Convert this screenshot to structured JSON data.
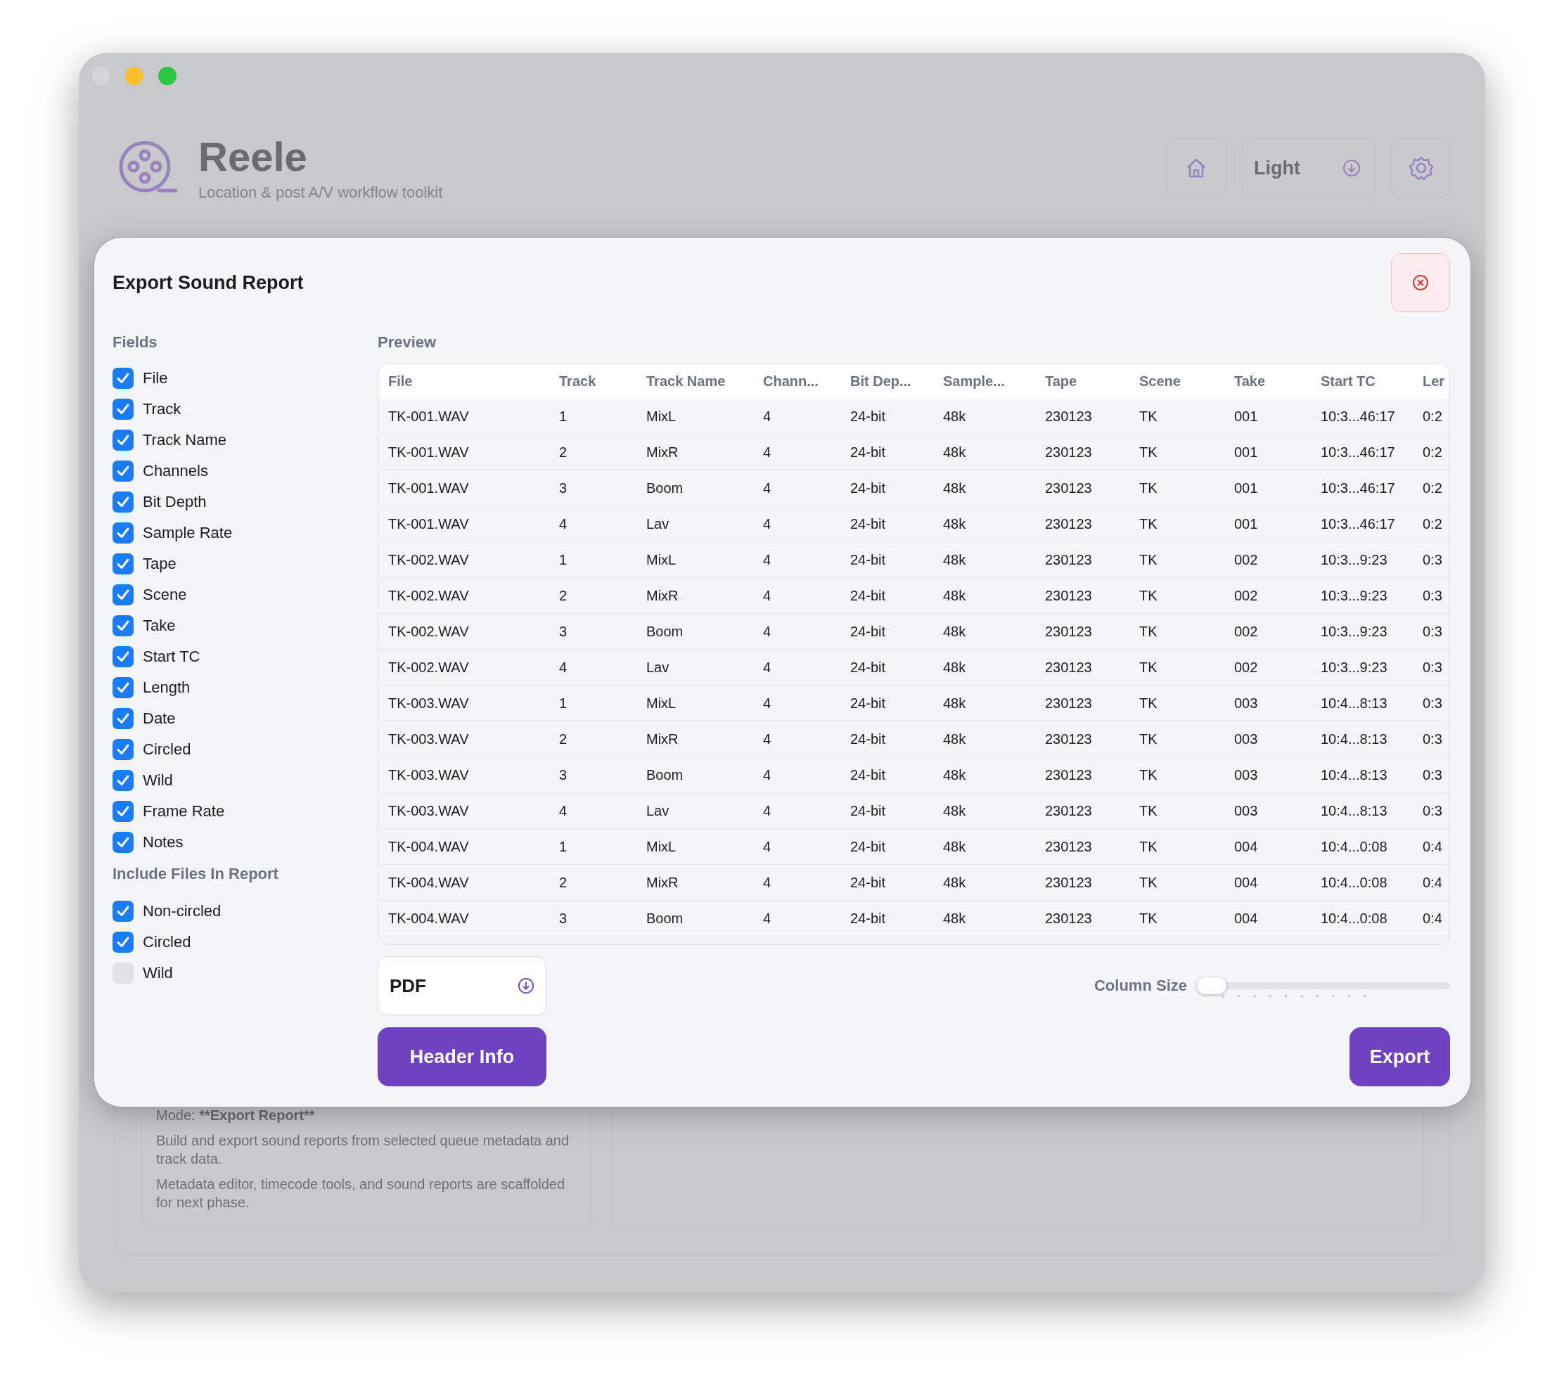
{
  "app": {
    "name": "Reele",
    "tagline": "Location & post A/V workflow toolkit",
    "theme": "Light"
  },
  "background": {
    "mode_label": "Mode:",
    "mode_value": "**Export Report**",
    "paragraphs": [
      "Build and export sound reports from selected queue metadata and track data.",
      "Metadata editor, timecode tools, and sound reports are scaffolded for next phase."
    ]
  },
  "dialog": {
    "title": "Export Sound Report",
    "fields_heading": "Fields",
    "fields": [
      {
        "label": "File",
        "checked": true
      },
      {
        "label": "Track",
        "checked": true
      },
      {
        "label": "Track Name",
        "checked": true
      },
      {
        "label": "Channels",
        "checked": true
      },
      {
        "label": "Bit Depth",
        "checked": true
      },
      {
        "label": "Sample Rate",
        "checked": true
      },
      {
        "label": "Tape",
        "checked": true
      },
      {
        "label": "Scene",
        "checked": true
      },
      {
        "label": "Take",
        "checked": true
      },
      {
        "label": "Start TC",
        "checked": true
      },
      {
        "label": "Length",
        "checked": true
      },
      {
        "label": "Date",
        "checked": true
      },
      {
        "label": "Circled",
        "checked": true
      },
      {
        "label": "Wild",
        "checked": true
      },
      {
        "label": "Frame Rate",
        "checked": true
      },
      {
        "label": "Notes",
        "checked": true
      }
    ],
    "include_heading": "Include Files In Report",
    "include": [
      {
        "label": "Non-circled",
        "checked": true
      },
      {
        "label": "Circled",
        "checked": true
      },
      {
        "label": "Wild",
        "checked": false
      }
    ],
    "preview_heading": "Preview",
    "table": {
      "columns": [
        "File",
        "Track",
        "Track Name",
        "Chann...",
        "Bit Dep...",
        "Sample...",
        "Tape",
        "Scene",
        "Take",
        "Start TC",
        "Ler"
      ],
      "rows": [
        [
          "TK-001.WAV",
          "1",
          "MixL",
          "4",
          "24-bit",
          "48k",
          "230123",
          "TK",
          "001",
          "10:3...46:17",
          "0:2"
        ],
        [
          "TK-001.WAV",
          "2",
          "MixR",
          "4",
          "24-bit",
          "48k",
          "230123",
          "TK",
          "001",
          "10:3...46:17",
          "0:2"
        ],
        [
          "TK-001.WAV",
          "3",
          "Boom",
          "4",
          "24-bit",
          "48k",
          "230123",
          "TK",
          "001",
          "10:3...46:17",
          "0:2"
        ],
        [
          "TK-001.WAV",
          "4",
          "Lav",
          "4",
          "24-bit",
          "48k",
          "230123",
          "TK",
          "001",
          "10:3...46:17",
          "0:2"
        ],
        [
          "TK-002.WAV",
          "1",
          "MixL",
          "4",
          "24-bit",
          "48k",
          "230123",
          "TK",
          "002",
          "10:3...9:23",
          "0:3"
        ],
        [
          "TK-002.WAV",
          "2",
          "MixR",
          "4",
          "24-bit",
          "48k",
          "230123",
          "TK",
          "002",
          "10:3...9:23",
          "0:3"
        ],
        [
          "TK-002.WAV",
          "3",
          "Boom",
          "4",
          "24-bit",
          "48k",
          "230123",
          "TK",
          "002",
          "10:3...9:23",
          "0:3"
        ],
        [
          "TK-002.WAV",
          "4",
          "Lav",
          "4",
          "24-bit",
          "48k",
          "230123",
          "TK",
          "002",
          "10:3...9:23",
          "0:3"
        ],
        [
          "TK-003.WAV",
          "1",
          "MixL",
          "4",
          "24-bit",
          "48k",
          "230123",
          "TK",
          "003",
          "10:4...8:13",
          "0:3"
        ],
        [
          "TK-003.WAV",
          "2",
          "MixR",
          "4",
          "24-bit",
          "48k",
          "230123",
          "TK",
          "003",
          "10:4...8:13",
          "0:3"
        ],
        [
          "TK-003.WAV",
          "3",
          "Boom",
          "4",
          "24-bit",
          "48k",
          "230123",
          "TK",
          "003",
          "10:4...8:13",
          "0:3"
        ],
        [
          "TK-003.WAV",
          "4",
          "Lav",
          "4",
          "24-bit",
          "48k",
          "230123",
          "TK",
          "003",
          "10:4...8:13",
          "0:3"
        ],
        [
          "TK-004.WAV",
          "1",
          "MixL",
          "4",
          "24-bit",
          "48k",
          "230123",
          "TK",
          "004",
          "10:4...0:08",
          "0:4"
        ],
        [
          "TK-004.WAV",
          "2",
          "MixR",
          "4",
          "24-bit",
          "48k",
          "230123",
          "TK",
          "004",
          "10:4...0:08",
          "0:4"
        ],
        [
          "TK-004.WAV",
          "3",
          "Boom",
          "4",
          "24-bit",
          "48k",
          "230123",
          "TK",
          "004",
          "10:4...0:08",
          "0:4"
        ]
      ]
    },
    "format": "PDF",
    "column_size": {
      "label": "Column Size",
      "level": 0
    },
    "header_info_button": "Header Info",
    "export_button": "Export"
  }
}
